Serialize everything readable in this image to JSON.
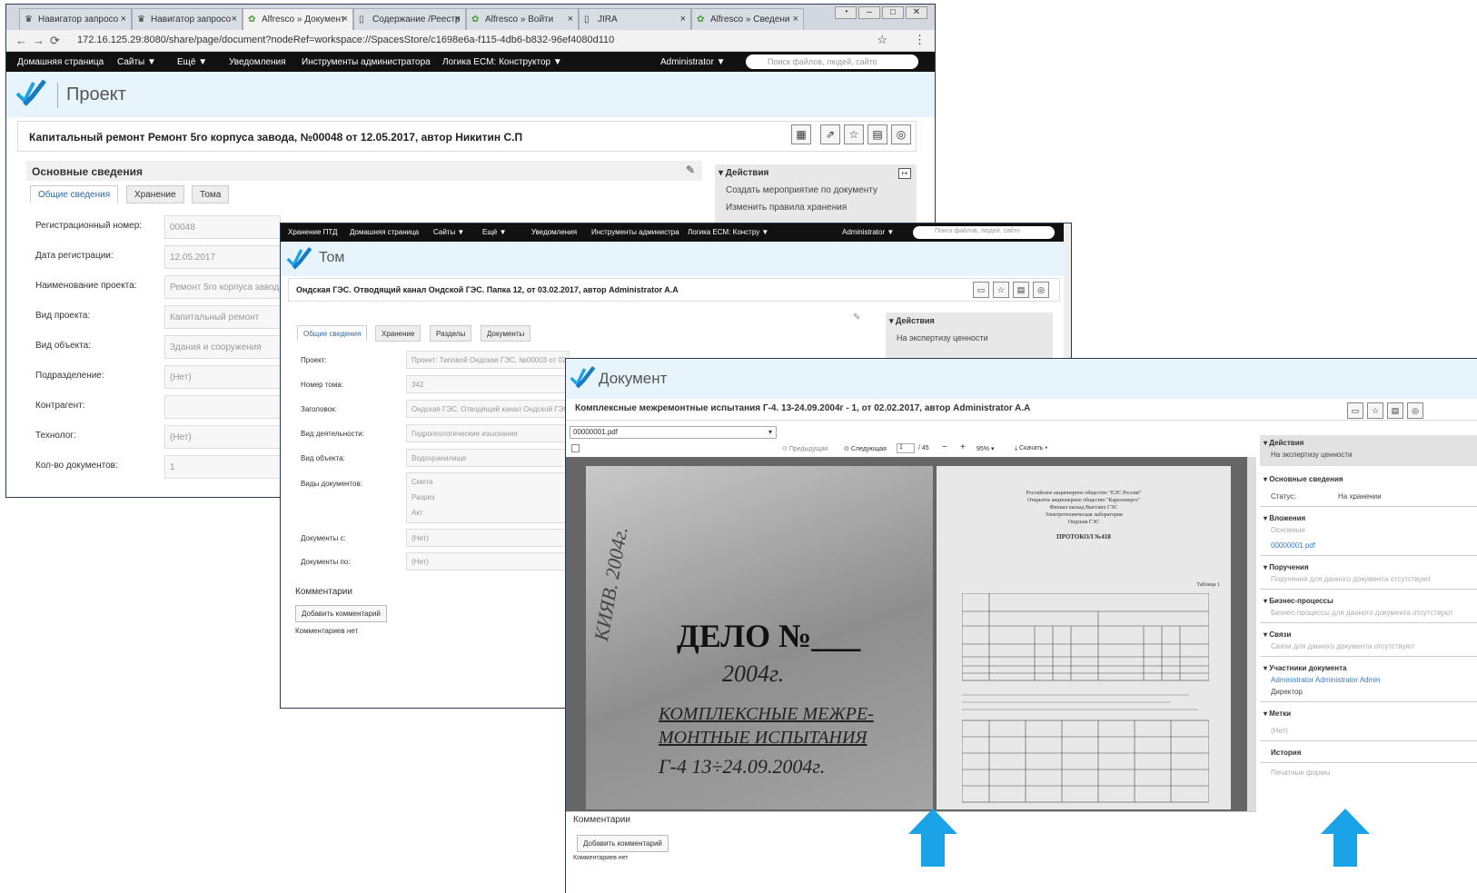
{
  "browser": {
    "tabs": [
      {
        "label": "Навигатор запросо",
        "icon": "crown-icon"
      },
      {
        "label": "Навигатор запросо",
        "icon": "crown-icon"
      },
      {
        "label": "Alfresco » Документ",
        "icon": "alfresco-icon",
        "active": true
      },
      {
        "label": "Содержание /Реестр",
        "icon": "page-icon"
      },
      {
        "label": "Alfresco » Войти",
        "icon": "alfresco-icon"
      },
      {
        "label": "JIRA",
        "icon": "page-icon"
      },
      {
        "label": "Alfresco » Сведени",
        "icon": "alfresco-icon"
      }
    ],
    "url": "172.16.125.29:8080/share/page/document?nodeRef=workspace://SpacesStore/c1698e6a-f115-4db6-b832-96ef4080d110"
  },
  "w1": {
    "nav": [
      "Домашняя страница",
      "Сайты ▼",
      "Ещё ▼",
      "Уведомления",
      "Инструменты администратора",
      "Логика ECM: Конструктор ▼"
    ],
    "user": "Administrator ▼",
    "search_placeholder": "Поиск файлов, людей, сайто",
    "site_title": "Проект",
    "doc_title": "Капитальный ремонт Ремонт 5го корпуса завода, №00048 от 12.05.2017, автор Никитин С.П",
    "section_title": "Основные сведения",
    "tabs": [
      "Общие сведения",
      "Хранение",
      "Тома"
    ],
    "fields": [
      {
        "label": "Регистрационный номер:",
        "value": "00048"
      },
      {
        "label": "Дата регистрации:",
        "value": "12.05.2017"
      },
      {
        "label": "Наименование проекта:",
        "value": "Ремонт 5го корпуса завода"
      },
      {
        "label": "Вид проекта:",
        "value": "Капитальный ремонт"
      },
      {
        "label": "Вид объекта:",
        "value": "Здания и сооружения"
      },
      {
        "label": "Подразделение:",
        "value": "(Нет)"
      },
      {
        "label": "Контрагент:",
        "value": ""
      },
      {
        "label": "Технолог:",
        "value": "(Нет)"
      },
      {
        "label": "Кол-во документов:",
        "value": "1"
      }
    ],
    "actions_title": "▾ Действия",
    "actions": [
      "Создать мероприятие по документу",
      "Изменить правила хранения"
    ]
  },
  "w2": {
    "nav": [
      "Хранение ПТД",
      "Домашняя страница",
      "Сайты ▼",
      "Ещё ▼",
      "Уведомления",
      "Инструменты администра",
      "Логика ECM: Констру ▼"
    ],
    "user": "Administrator ▼",
    "search_placeholder": "Поиск файлов, людей, сайто",
    "site_title": "Том",
    "doc_title": "Ондская ГЭС. Отводящий канал Ондской ГЭС. Папка 12, от 03.02.2017, автор Administrator A.A",
    "tabs": [
      "Общие сведения",
      "Хранение",
      "Разделы",
      "Документы"
    ],
    "fields": [
      {
        "label": "Проект:",
        "value": "Проект: Типовой Ондская ГЭС, №00003 от 02.02.2017"
      },
      {
        "label": "Номер тома:",
        "value": "342"
      },
      {
        "label": "Заголовок:",
        "value": "Ондская ГЭС. Отводящий канал Ондской ГЭС"
      },
      {
        "label": "Вид деятельности:",
        "value": "Гидрогеологические изыскания"
      },
      {
        "label": "Вид объекта:",
        "value": "Водохранилище"
      }
    ],
    "doc_types_label": "Виды документов:",
    "doc_types": [
      "Смета",
      "Разрез",
      "Акт"
    ],
    "date_fields": [
      {
        "label": "Документы с:",
        "value": "(Нет)"
      },
      {
        "label": "Документы по:",
        "value": "(Нет)"
      }
    ],
    "comments_title": "Комментарии",
    "add_comment": "Добавить комментарий",
    "no_comments": "Комментариев нет",
    "actions_title": "▾ Действия",
    "actions": [
      "На экспертизу ценности"
    ]
  },
  "w3": {
    "site_title": "Документ",
    "doc_title": "Комплексные межремонтные испытания Г-4. 13-24.09.2004г - 1, от 02.02.2017, автор Administrator A.A",
    "file_select": "00000001.pdf",
    "viewer": {
      "prev": "Предыдущая",
      "next": "Следующая",
      "page": "1",
      "total": "/ 45",
      "zoom": "95% ▾",
      "download": "Скачать ▾"
    },
    "scan_left": {
      "line1": "ДЕЛО №___",
      "line2": "2004г.",
      "line3": "КОМПЛЕКСНЫЕ МЕЖРЕ-",
      "line4": "МОНТНЫЕ ИСПЫТАНИЯ",
      "line5": "Г-4    13÷24.09.2004г.",
      "side": "КИЯВ. 2004г."
    },
    "scan_right": {
      "head1": "Российское акционерное общество \"ЕЭС России\"",
      "head2": "Открытое акционерное общество \"Карелэнерго\"",
      "head3": "Филиал каскад Выгских ГЭС",
      "head4": "Электротехническая лаборатория",
      "head5": "Ондская ГЭС",
      "protocol": "ПРОТОКОЛ №418",
      "table_title": "Таблица 1"
    },
    "comments_title": "Комментарии",
    "add_comment": "Добавить комментарий",
    "no_comments": "Комментариев нет",
    "panel": {
      "actions_h": "▾ Действия",
      "actions_v": "На экспертизу ценности",
      "info_h": "▾ Основные сведения",
      "status_l": "Статус:",
      "status_v": "На хранении",
      "att_h": "▾ Вложения",
      "att_sub": "Основные",
      "att_file": "00000001.pdf",
      "task_h": "▾ Поручения",
      "task_v": "Поручения для данного документа отсутствуют",
      "bp_h": "▾ Бизнес-процессы",
      "bp_v": "Бизнес-процессы для данного документа отсутствуют",
      "links_h": "▾ Связи",
      "links_v": "Связи для данного документа отсутствуют",
      "part_h": "▾ Участники документа",
      "part_v": "Administrator Administrator Admin",
      "part_role": "Директор",
      "tags_h": "▾ Метки",
      "tags_v": "(Нет)",
      "hist_h": "История",
      "print_h": "Печатные формы"
    }
  },
  "colors": {
    "accent": "#1aa3e6",
    "nav_bg": "#111111",
    "header_bg": "#e7f4fb"
  }
}
